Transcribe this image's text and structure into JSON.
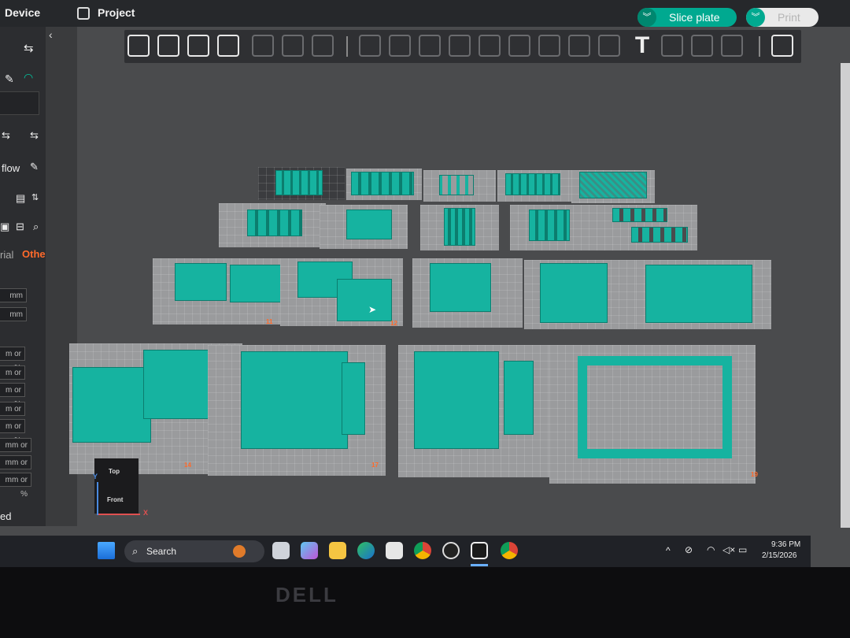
{
  "topbar": {
    "device_label": "Device",
    "project_label": "Project",
    "slice_button": "Slice plate",
    "print_button": "Print"
  },
  "sidebar": {
    "flow_label": "flow",
    "tab_material": "rial",
    "tab_others": "Others",
    "unit_mm": "mm",
    "mm_or_pct": "m or %",
    "mm_or_pct_full": "mm or %",
    "footer_text": "ed"
  },
  "view_cube": {
    "top_label": "Top",
    "front_label": "Front",
    "x_axis": "X",
    "y_axis": "Y"
  },
  "plates": [
    {
      "number": "11"
    },
    {
      "number": "12"
    },
    {
      "number": "14"
    },
    {
      "number": "16"
    },
    {
      "number": "17"
    },
    {
      "number": "18"
    },
    {
      "number": "19"
    }
  ],
  "taskbar": {
    "search_placeholder": "Search",
    "time": "9:36 PM",
    "date": "2/15/2026"
  },
  "monitor": {
    "brand": "DELL"
  },
  "colors": {
    "accent": "#00a990",
    "part": "#16b3a0",
    "tab_active": "#ff6a2b"
  }
}
